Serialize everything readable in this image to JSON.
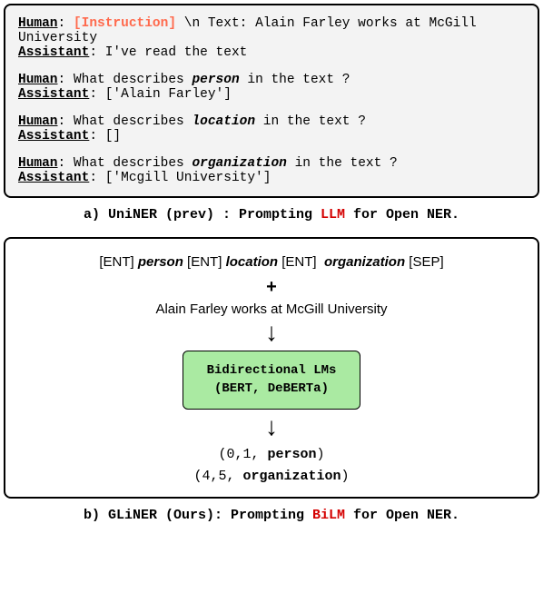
{
  "panel_a": {
    "turn1_human_role": "Human",
    "turn1_instruction_marker": "[Instruction]",
    "turn1_tail": " \\n Text: Alain Farley works at McGill University",
    "turn1_assistant_role": "Assistant",
    "turn1_assistant_text": "I've read the text",
    "turn2_human_role": "Human",
    "turn2_q_pre": "What describes ",
    "turn2_q_entity": "person",
    "turn2_q_post": " in the text ?",
    "turn2_assistant_role": "Assistant",
    "turn2_answer": "['Alain Farley']",
    "turn3_human_role": "Human",
    "turn3_q_pre": "What describes ",
    "turn3_q_entity": "location",
    "turn3_q_post": " in the text ?",
    "turn3_assistant_role": "Assistant",
    "turn3_answer": "[]",
    "turn4_human_role": "Human",
    "turn4_q_pre": "What describes ",
    "turn4_q_entity": "organization",
    "turn4_q_post": " in the text ?",
    "turn4_assistant_role": "Assistant",
    "turn4_answer": "['Mcgill University']"
  },
  "caption_a": {
    "pre": "a) UniNER (prev) : Prompting ",
    "red": "LLM",
    "post": " for Open NER."
  },
  "panel_b": {
    "tok1": "[ENT]",
    "ent1": "person",
    "tok2": "[ENT]",
    "ent2": "location",
    "tok3": "[ENT]",
    "ent3": "organization",
    "tok4": "[SEP]",
    "plus": "+",
    "input_text": "Alain Farley works at McGill University",
    "arrow1": "↓",
    "lm_line1": "Bidirectional LMs",
    "lm_line2": "(BERT, DeBERTa)",
    "arrow2": "↓",
    "out1_pre": "(0,1, ",
    "out1_b": "person",
    "out1_post": ")",
    "out2_pre": "(4,5, ",
    "out2_b": "organization",
    "out2_post": ")"
  },
  "caption_b": {
    "pre": "b) GLiNER (Ours): Prompting ",
    "red": "BiLM",
    "post": " for Open NER."
  }
}
